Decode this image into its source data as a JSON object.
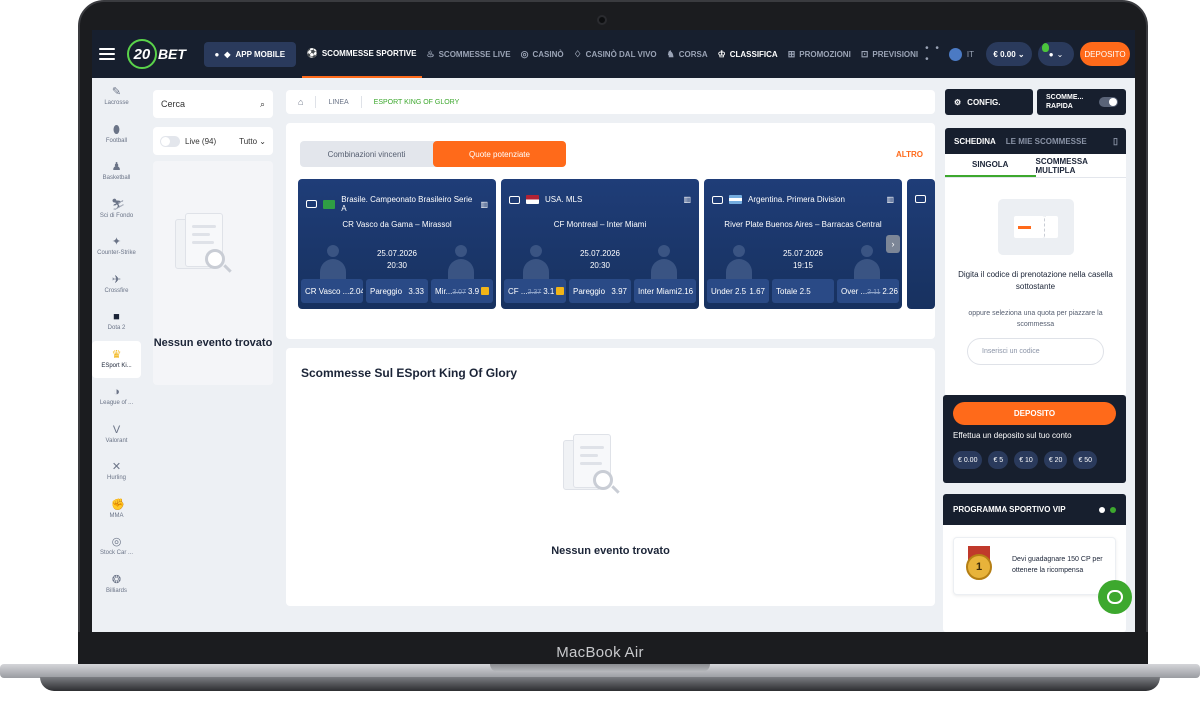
{
  "device": {
    "brand": "MacBook Air"
  },
  "header": {
    "logo_number": "20",
    "logo_text": "BET",
    "app_button": "APP MOBILE",
    "nav": [
      {
        "label": "SCOMMESSE SPORTIVE",
        "icon": "soccer-ball-icon"
      },
      {
        "label": "SCOMMESSE LIVE",
        "icon": "flame-icon"
      },
      {
        "label": "CASINÒ",
        "icon": "chip-icon"
      },
      {
        "label": "CASINÒ DAL VIVO",
        "icon": "cards-icon"
      },
      {
        "label": "CORSA",
        "icon": "horse-icon"
      },
      {
        "label": "CLASSIFICA",
        "icon": "trophy-icon"
      },
      {
        "label": "PROMOZIONI",
        "icon": "gift-icon"
      },
      {
        "label": "PREVISIONI",
        "icon": "chart-icon"
      }
    ],
    "more": "• • •",
    "lang": "IT",
    "balance": "€ 0.00 ⌄",
    "user": "⌄",
    "deposit": "DEPOSITO"
  },
  "rail": [
    {
      "label": "Lacrosse",
      "icon": "✎"
    },
    {
      "label": "Football",
      "icon": "⬮"
    },
    {
      "label": "Basketball",
      "icon": "♟"
    },
    {
      "label": "Sci di Fondo",
      "icon": "⛷"
    },
    {
      "label": "Counter-Strike",
      "icon": "✦"
    },
    {
      "label": "Crossfire",
      "icon": "✈"
    },
    {
      "label": "Dota 2",
      "icon": "■"
    },
    {
      "label": "ESport Ki...",
      "icon": "♛"
    },
    {
      "label": "League of ...",
      "icon": "◑"
    },
    {
      "label": "Valorant",
      "icon": "V"
    },
    {
      "label": "Hurling",
      "icon": "✕"
    },
    {
      "label": "MMA",
      "icon": "✊"
    },
    {
      "label": "Stock Car ...",
      "icon": "◎"
    },
    {
      "label": "Billiards",
      "icon": "❂"
    }
  ],
  "search": {
    "placeholder": "Cerca",
    "icon": "🔍"
  },
  "live": {
    "label": "Live (94)",
    "filter": "Tutto ⌄"
  },
  "left_empty": "Nessun evento trovato",
  "breadcrumb": {
    "home": "⌂",
    "line": "LINEA",
    "current": "ESPORT KING OF GLORY"
  },
  "boost": {
    "tabs": [
      "Combinazioni vincenti",
      "Quote potenziate"
    ],
    "more": "ALTRO",
    "cards": [
      {
        "league": "Brasile. Campeonato Brasileiro Serie A",
        "flag": [
          "#2f9e44",
          "#f2c418"
        ],
        "match": "CR Vasco da Gama – Mirassol",
        "date": "25.07.2026",
        "time": "20:30",
        "odds": [
          {
            "label": "CR Vasco ...",
            "old": "",
            "value": "2.04"
          },
          {
            "label": "Pareggio",
            "old": "",
            "value": "3.33"
          },
          {
            "label": "Mir...",
            "old": "3.07",
            "value": "3.9"
          }
        ]
      },
      {
        "league": "USA. MLS",
        "flag": [
          "#b22234",
          "#3c3b6e"
        ],
        "match": "CF Montreal – Inter Miami",
        "date": "25.07.2026",
        "time": "20:30",
        "odds": [
          {
            "label": "CF ...",
            "old": "2.37",
            "value": "3.1"
          },
          {
            "label": "Pareggio",
            "old": "",
            "value": "3.97"
          },
          {
            "label": "Inter Miami",
            "old": "",
            "value": "2.16"
          }
        ]
      },
      {
        "league": "Argentina. Primera Division",
        "flag": [
          "#74acdf",
          "#ffffff"
        ],
        "match": "River Plate Buenos Aires – Barracas Central",
        "date": "25.07.2026",
        "time": "19:15",
        "odds": [
          {
            "label": "Under 2.5",
            "old": "",
            "value": "1.67"
          },
          {
            "label": "Totale 2.5",
            "old": "",
            "value": ""
          },
          {
            "label": "Over ...",
            "old": "2.11",
            "value": "2.26"
          }
        ]
      }
    ],
    "next": "›"
  },
  "bets": {
    "title": "Scommesse Sul ESport King Of Glory",
    "empty": "Nessun evento trovato"
  },
  "right": {
    "config": "CONFIG.",
    "quick_line1": "SCOMME...",
    "quick_line2": "RAPIDA",
    "slip_tab_active": "SCHEDINA",
    "slip_tab_other": "LE MIE SCOMMESSE",
    "trash": "🗑",
    "single": "SINGOLA",
    "multiple": "SCOMMESSA MULTIPLA",
    "code_hint": "Digita il codice di prenotazione nella casella sottostante",
    "select_hint": "oppure seleziona una quota per piazzare la scommessa",
    "code_placeholder": "Inserisci un codice",
    "deposit_btn": "DEPOSITO",
    "deposit_sub": "Effettua un deposito sul tuo conto",
    "amounts": [
      "€ 0.00",
      "€ 5",
      "€ 10",
      "€ 20",
      "€ 50"
    ],
    "vip_title": "PROGRAMMA SPORTIVO VIP",
    "vip_rank": "1",
    "vip_text": "Devi guadagnare 150 CP per ottenere la ricompensa"
  },
  "colors": {
    "accent": "#ff6a1a",
    "green": "#3da82e",
    "dark": "#171f2e",
    "card": "#1f3d78"
  }
}
